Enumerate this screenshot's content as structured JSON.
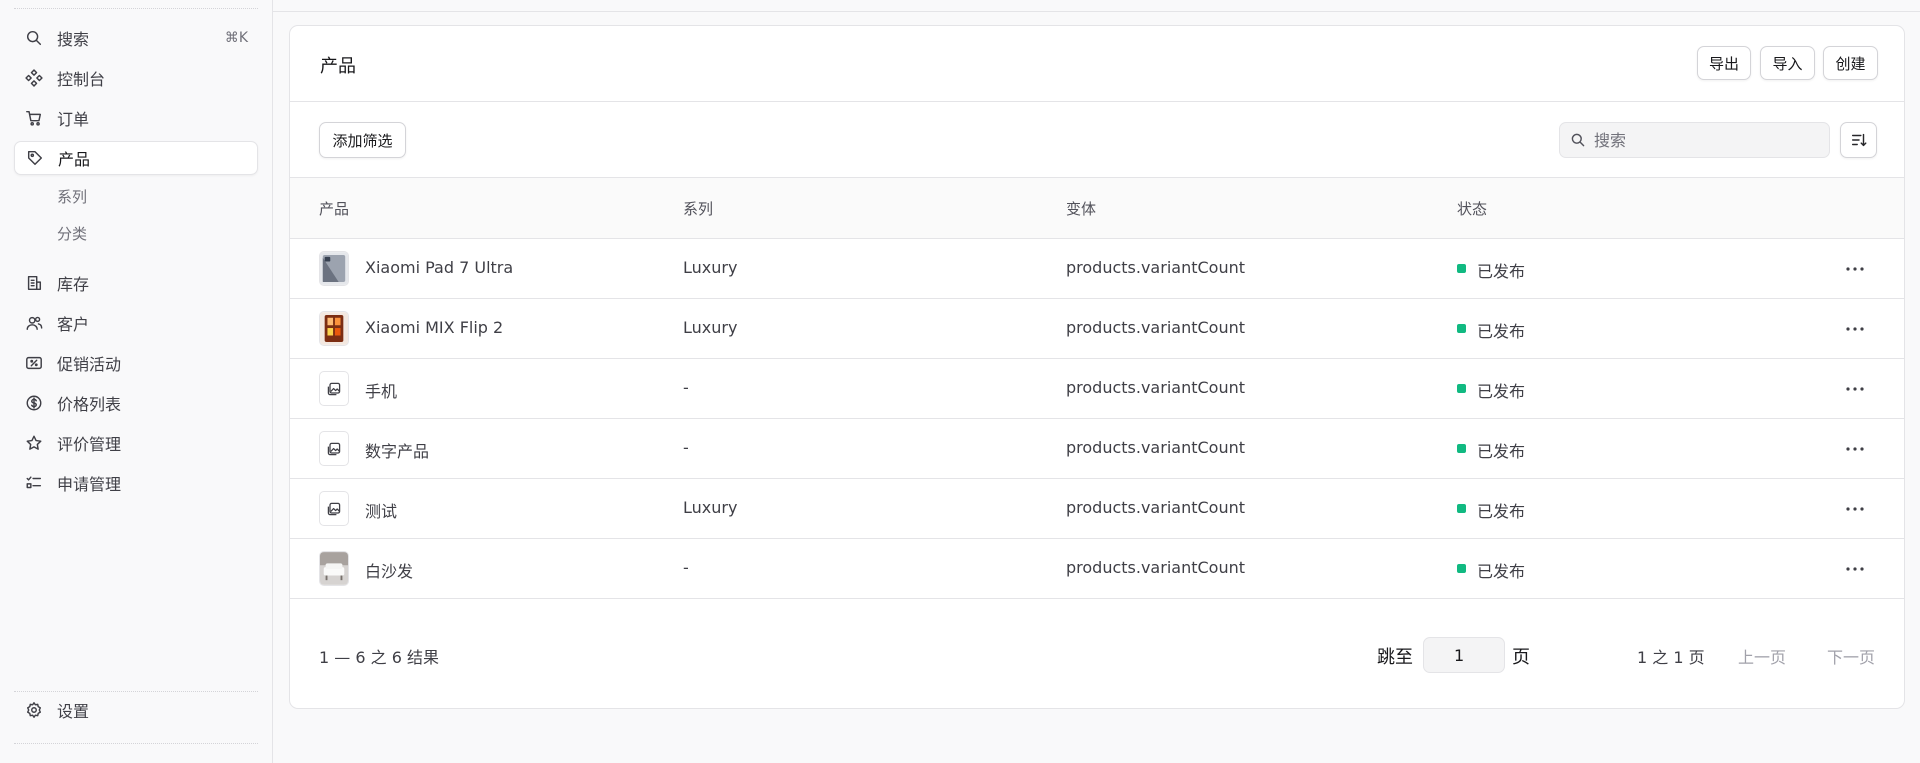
{
  "sidebar": {
    "search": {
      "label": "搜索",
      "shortcut": "⌘K",
      "icon": "search-icon"
    },
    "items": [
      {
        "label": "控制台",
        "icon": "dashboard-icon"
      },
      {
        "label": "订单",
        "icon": "cart-icon"
      },
      {
        "label": "产品",
        "icon": "tag-icon",
        "active": true
      },
      {
        "label": "库存",
        "icon": "building-icon"
      },
      {
        "label": "客户",
        "icon": "users-icon"
      },
      {
        "label": "促销活动",
        "icon": "receipt-percent-icon"
      },
      {
        "label": "价格列表",
        "icon": "currency-dollar-icon"
      },
      {
        "label": "评价管理",
        "icon": "star-icon"
      },
      {
        "label": "申请管理",
        "icon": "checklist-icon"
      }
    ],
    "sub_items": [
      "系列",
      "分类"
    ],
    "settings": {
      "label": "设置",
      "icon": "gear-icon"
    }
  },
  "header": {
    "title": "产品",
    "export_label": "导出",
    "import_label": "导入",
    "create_label": "创建"
  },
  "toolbar": {
    "add_filter_label": "添加筛选",
    "search_placeholder": "搜索"
  },
  "table": {
    "columns": [
      "产品",
      "系列",
      "变体",
      "状态"
    ],
    "rows": [
      {
        "name": "Xiaomi Pad 7 Ultra",
        "collection": "Luxury",
        "variants": "products.variantCount",
        "status": "已发布",
        "thumb": "tablet-photo"
      },
      {
        "name": "Xiaomi MIX Flip 2",
        "collection": "Luxury",
        "variants": "products.variantCount",
        "status": "已发布",
        "thumb": "phone-photo"
      },
      {
        "name": "手机",
        "collection": "-",
        "variants": "products.variantCount",
        "status": "已发布",
        "thumb": "placeholder-image-icon"
      },
      {
        "name": "数字产品",
        "collection": "-",
        "variants": "products.variantCount",
        "status": "已发布",
        "thumb": "placeholder-image-icon"
      },
      {
        "name": "测试",
        "collection": "Luxury",
        "variants": "products.variantCount",
        "status": "已发布",
        "thumb": "placeholder-image-icon"
      },
      {
        "name": "白沙发",
        "collection": "-",
        "variants": "products.variantCount",
        "status": "已发布",
        "thumb": "sofa-photo"
      }
    ]
  },
  "pagination": {
    "summary": "1 — 6 之 6 结果",
    "jump_label": "跳至",
    "page_value": "1",
    "page_unit": "页",
    "page_info": "1 之 1 页",
    "prev_label": "上一页",
    "next_label": "下一页"
  },
  "colors": {
    "accent_status": "#10b981",
    "background": "#f9f9fa",
    "border": "#e4e4e7"
  }
}
